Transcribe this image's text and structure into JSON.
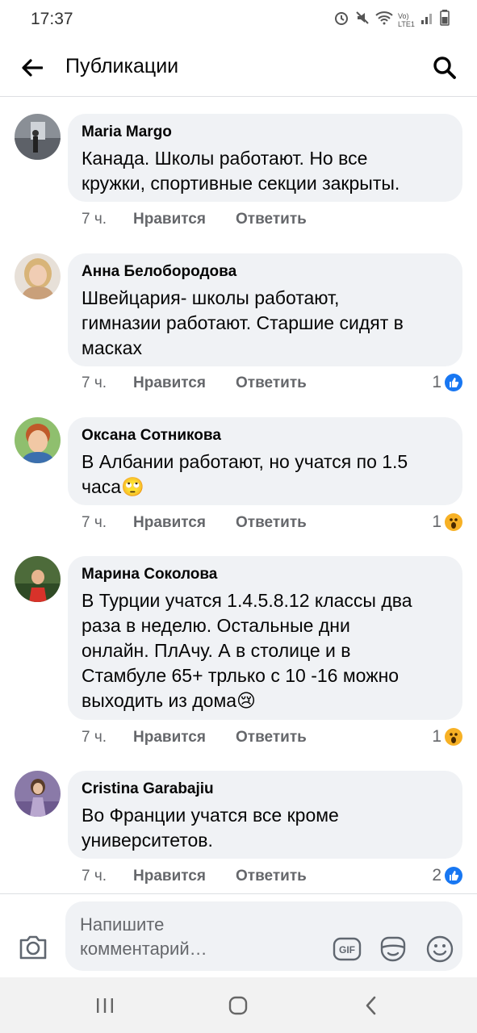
{
  "status": {
    "time": "17:37",
    "network": "Vo) LTE1"
  },
  "header": {
    "title": "Публикации"
  },
  "comments": [
    {
      "author": "Maria Margo",
      "text": "Канада. Школы работают. Но все\nкружки, спортивные секции закрыты.",
      "time": "7 ч.",
      "like": "Нравится",
      "reply": "Ответить",
      "reactions": "",
      "reaction_type": ""
    },
    {
      "author": "Анна Белобородова",
      "text": "Швейцария- школы работают,\nгимназии работают. Старшие сидят в\nмасках",
      "time": "7 ч.",
      "like": "Нравится",
      "reply": "Ответить",
      "reactions": "1",
      "reaction_type": "like"
    },
    {
      "author": "Оксана Сотникова",
      "text": "В Албании работают, но учатся по 1.5\nчаса🙄",
      "time": "7 ч.",
      "like": "Нравится",
      "reply": "Ответить",
      "reactions": "1",
      "reaction_type": "wow"
    },
    {
      "author": "Марина Соколова",
      "text": "В Турции учатся 1.4.5.8.12 классы два\nраза в неделю. Остальные дни\nонлайн. ПлАчу. А в столице и в\nСтамбуле 65+ трлько с 10 -16 можно\nвыходить из дома😢",
      "time": "7 ч.",
      "like": "Нравится",
      "reply": "Ответить",
      "reactions": "1",
      "reaction_type": "wow"
    },
    {
      "author": "Cristina Garabajiu",
      "text": "Во Франции учатся все кроме\nуниверситетов.",
      "time": "7 ч.",
      "like": "Нравится",
      "reply": "Ответить",
      "reactions": "2",
      "reaction_type": "like"
    }
  ],
  "composer": {
    "placeholder": "Напишите\nкомментарий…"
  },
  "colors": {
    "accent": "#1877f2",
    "bubble": "#f0f2f5",
    "meta": "#65676b"
  }
}
